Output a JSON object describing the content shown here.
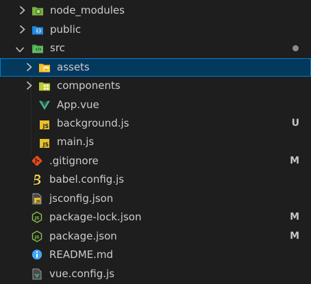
{
  "explorer": {
    "items": [
      {
        "label": "node_modules",
        "icon": "node-modules-folder-icon",
        "type": "folder",
        "expanded": false,
        "status": ""
      },
      {
        "label": "public",
        "icon": "public-folder-icon",
        "type": "folder",
        "expanded": false,
        "status": ""
      },
      {
        "label": "src",
        "icon": "src-folder-icon",
        "type": "folder",
        "expanded": true,
        "status": "modified-dot"
      },
      {
        "label": "assets",
        "icon": "assets-folder-icon",
        "type": "folder",
        "expanded": false,
        "selected": true,
        "status": ""
      },
      {
        "label": "components",
        "icon": "components-folder-icon",
        "type": "folder",
        "expanded": false,
        "status": ""
      },
      {
        "label": "App.vue",
        "icon": "vue-file-icon",
        "type": "file",
        "status": ""
      },
      {
        "label": "background.js",
        "icon": "js-file-icon",
        "type": "file",
        "status": "U"
      },
      {
        "label": "main.js",
        "icon": "js-file-icon",
        "type": "file",
        "status": ""
      },
      {
        "label": ".gitignore",
        "icon": "git-file-icon",
        "type": "file",
        "status": "M"
      },
      {
        "label": "babel.config.js",
        "icon": "babel-file-icon",
        "type": "file",
        "status": ""
      },
      {
        "label": "jsconfig.json",
        "icon": "jsconfig-file-icon",
        "type": "file",
        "status": ""
      },
      {
        "label": "package-lock.json",
        "icon": "npm-json-file-icon",
        "type": "file",
        "status": "M"
      },
      {
        "label": "package.json",
        "icon": "npm-json-file-icon",
        "type": "file",
        "status": "M"
      },
      {
        "label": "README.md",
        "icon": "info-file-icon",
        "type": "file",
        "status": ""
      },
      {
        "label": "vue.config.js",
        "icon": "config-js-file-icon",
        "type": "file",
        "status": ""
      }
    ],
    "colors": {
      "background": "#1e1e1e",
      "selection": "#04395e",
      "selection_border": "#007fd4",
      "text": "#cccccc"
    }
  }
}
